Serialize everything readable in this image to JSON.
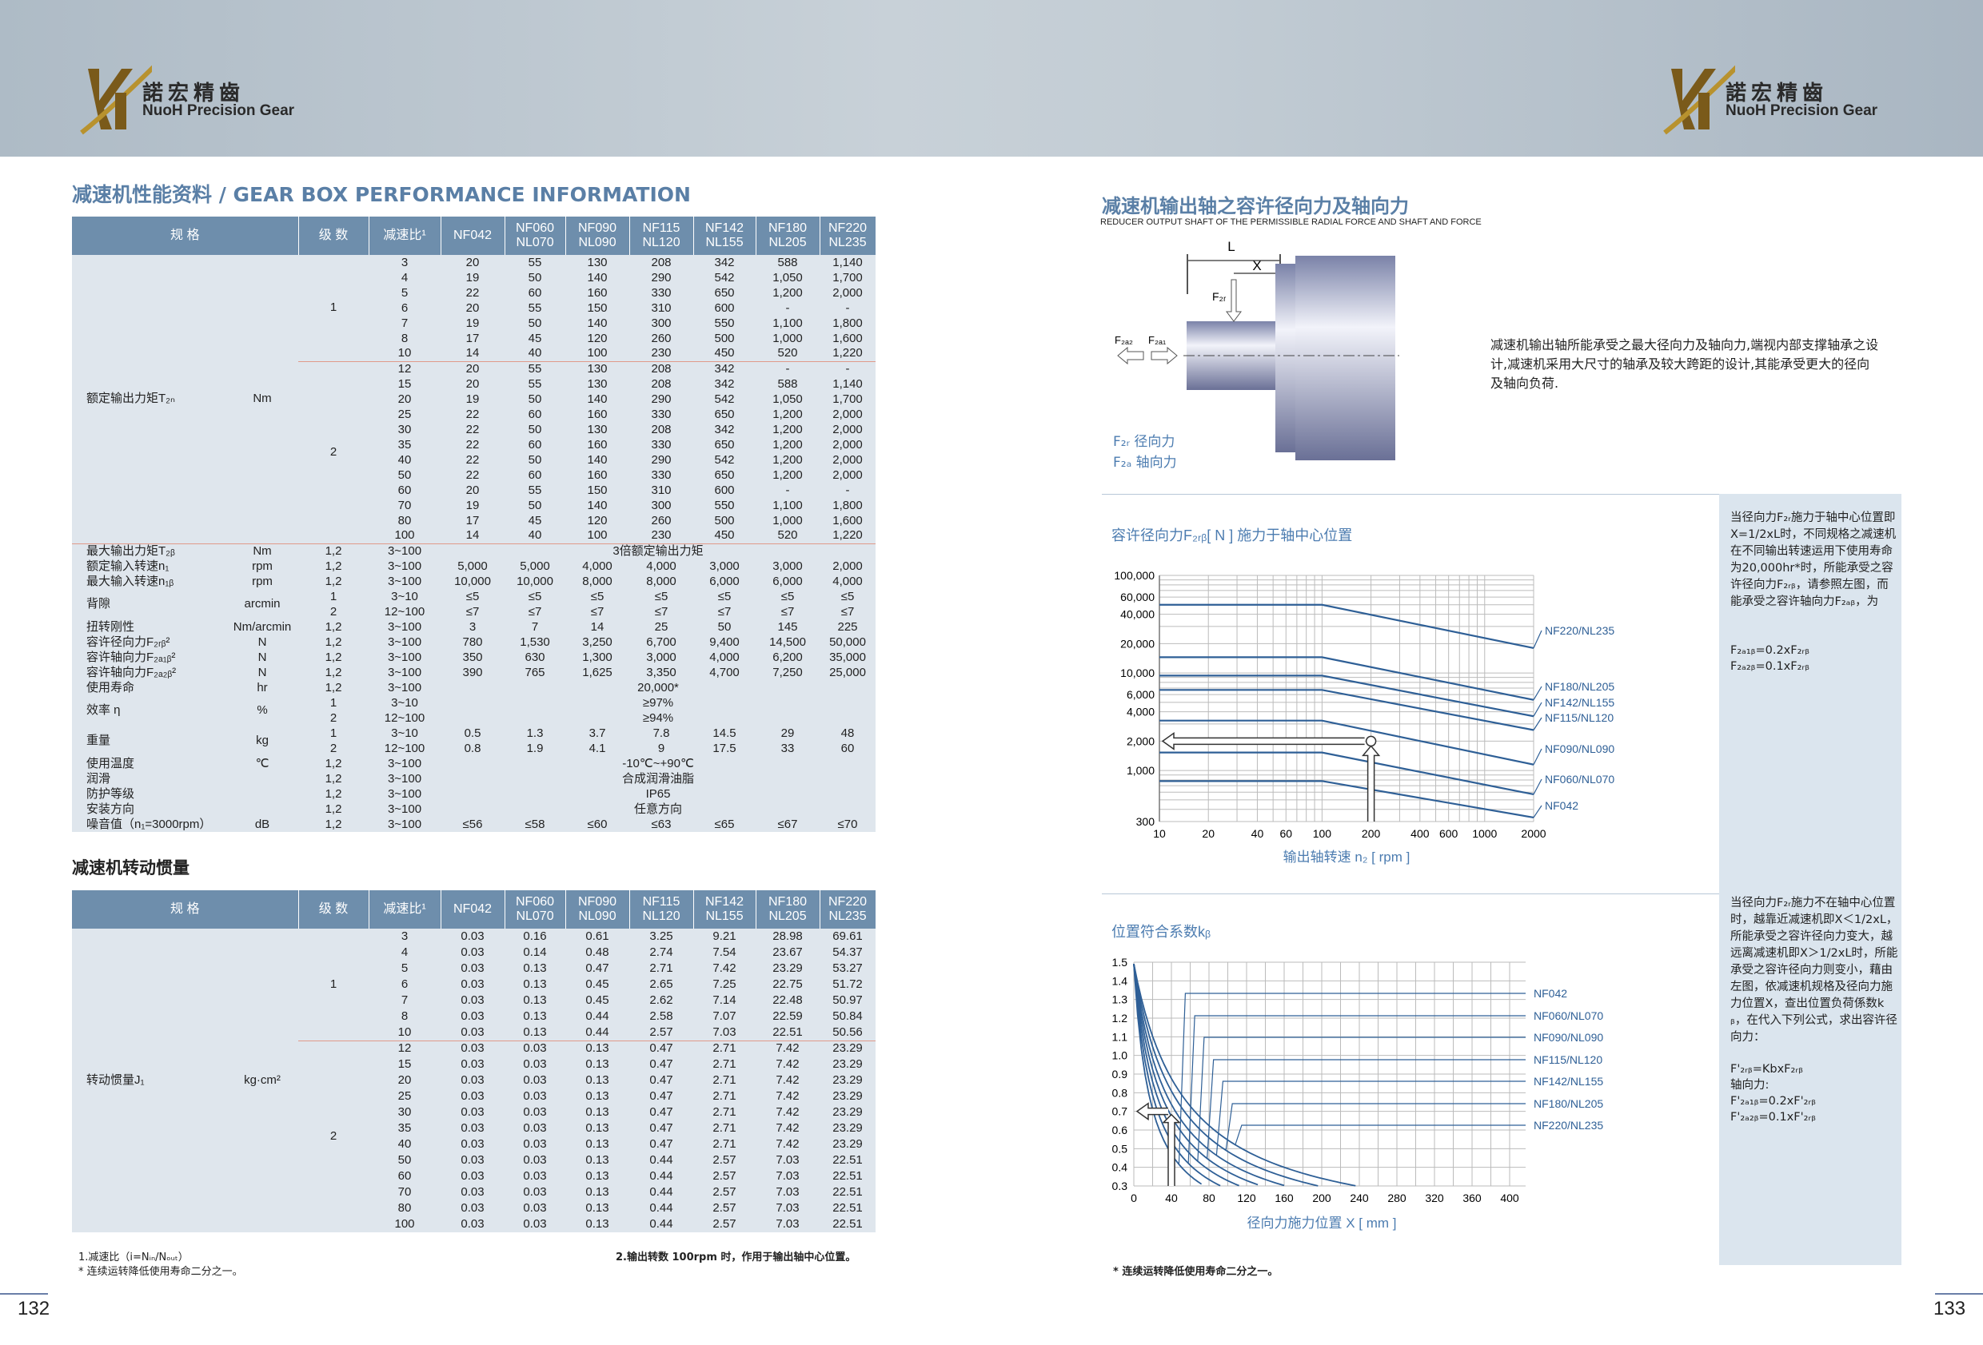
{
  "brand": {
    "cn": "諾宏精齒",
    "en": "NuoH Precision Gear"
  },
  "left": {
    "title": "减速机性能资料 / GEAR BOX PERFORMANCE INFORMATION",
    "columns": [
      "规 格",
      "级 数",
      "减速比¹",
      "NF042",
      "NF060\nNL070",
      "NF090\nNL090",
      "NF115\nNL120",
      "NF142\nNL155",
      "NF180\nNL205",
      "NF220\nNL235"
    ],
    "torque": {
      "label": "额定输出力矩T₂ₙ",
      "unit": "Nm",
      "stages": [
        {
          "stage": "1",
          "rows": [
            [
              "3",
              "20",
              "55",
              "130",
              "208",
              "342",
              "588",
              "1,140"
            ],
            [
              "4",
              "19",
              "50",
              "140",
              "290",
              "542",
              "1,050",
              "1,700"
            ],
            [
              "5",
              "22",
              "60",
              "160",
              "330",
              "650",
              "1,200",
              "2,000"
            ],
            [
              "6",
              "20",
              "55",
              "150",
              "310",
              "600",
              "-",
              "-"
            ],
            [
              "7",
              "19",
              "50",
              "140",
              "300",
              "550",
              "1,100",
              "1,800"
            ],
            [
              "8",
              "17",
              "45",
              "120",
              "260",
              "500",
              "1,000",
              "1,600"
            ],
            [
              "10",
              "14",
              "40",
              "100",
              "230",
              "450",
              "520",
              "1,220"
            ]
          ]
        },
        {
          "stage": "2",
          "rows": [
            [
              "12",
              "20",
              "55",
              "130",
              "208",
              "342",
              "-",
              "-"
            ],
            [
              "15",
              "20",
              "55",
              "130",
              "208",
              "342",
              "588",
              "1,140"
            ],
            [
              "20",
              "19",
              "50",
              "140",
              "290",
              "542",
              "1,050",
              "1,700"
            ],
            [
              "25",
              "22",
              "60",
              "160",
              "330",
              "650",
              "1,200",
              "2,000"
            ],
            [
              "30",
              "22",
              "50",
              "130",
              "208",
              "342",
              "1,200",
              "2,000"
            ],
            [
              "35",
              "22",
              "60",
              "160",
              "330",
              "650",
              "1,200",
              "2,000"
            ],
            [
              "40",
              "22",
              "50",
              "140",
              "290",
              "542",
              "1,200",
              "2,000"
            ],
            [
              "50",
              "22",
              "60",
              "160",
              "330",
              "650",
              "1,200",
              "2,000"
            ],
            [
              "60",
              "20",
              "55",
              "150",
              "310",
              "600",
              "-",
              "-"
            ],
            [
              "70",
              "19",
              "50",
              "140",
              "300",
              "550",
              "1,100",
              "1,800"
            ],
            [
              "80",
              "17",
              "45",
              "120",
              "260",
              "500",
              "1,000",
              "1,600"
            ],
            [
              "100",
              "14",
              "40",
              "100",
              "230",
              "450",
              "520",
              "1,220"
            ]
          ]
        }
      ]
    },
    "specs": [
      {
        "label": "最大输出力矩T₂ᵦ",
        "unit": "Nm",
        "stage": "1,2",
        "ratio": "3~100",
        "span": "3倍额定输出力矩"
      },
      {
        "label": "额定输入转速n₁",
        "unit": "rpm",
        "stage": "1,2",
        "ratio": "3~100",
        "vals": [
          "5,000",
          "5,000",
          "4,000",
          "4,000",
          "3,000",
          "3,000",
          "2,000"
        ]
      },
      {
        "label": "最大输入转速n₁ᵦ",
        "unit": "rpm",
        "stage": "1,2",
        "ratio": "3~100",
        "vals": [
          "10,000",
          "10,000",
          "8,000",
          "8,000",
          "6,000",
          "6,000",
          "4,000"
        ]
      },
      {
        "label": "背隙",
        "unit": "arcmin",
        "stage": "1",
        "ratio": "3~10",
        "vals": [
          "≤5",
          "≤5",
          "≤5",
          "≤5",
          "≤5",
          "≤5",
          "≤5"
        ]
      },
      {
        "label": "",
        "unit": "",
        "stage": "2",
        "ratio": "12~100",
        "vals": [
          "≤7",
          "≤7",
          "≤7",
          "≤7",
          "≤7",
          "≤7",
          "≤7"
        ]
      },
      {
        "label": "扭转刚性",
        "unit": "Nm/arcmin",
        "stage": "1,2",
        "ratio": "3~100",
        "vals": [
          "3",
          "7",
          "14",
          "25",
          "50",
          "145",
          "225"
        ]
      },
      {
        "label": "容许径向力F₂ᵣᵦ²",
        "unit": "N",
        "stage": "1,2",
        "ratio": "3~100",
        "vals": [
          "780",
          "1,530",
          "3,250",
          "6,700",
          "9,400",
          "14,500",
          "50,000"
        ]
      },
      {
        "label": "容许轴向力F₂ₐ₁ᵦ²",
        "unit": "N",
        "stage": "1,2",
        "ratio": "3~100",
        "vals": [
          "350",
          "630",
          "1,300",
          "3,000",
          "4,000",
          "6,200",
          "35,000"
        ]
      },
      {
        "label": "容许轴向力F₂ₐ₂ᵦ²",
        "unit": "N",
        "stage": "1,2",
        "ratio": "3~100",
        "vals": [
          "390",
          "765",
          "1,625",
          "3,350",
          "4,700",
          "7,250",
          "25,000"
        ]
      },
      {
        "label": "使用寿命",
        "unit": "hr",
        "stage": "1,2",
        "ratio": "3~100",
        "span": "20,000*"
      },
      {
        "label": "效率 η",
        "unit": "%",
        "stage": "1",
        "ratio": "3~10",
        "span": "≥97%"
      },
      {
        "label": "",
        "unit": "",
        "stage": "2",
        "ratio": "12~100",
        "span": "≥94%"
      },
      {
        "label": "重量",
        "unit": "kg",
        "stage": "1",
        "ratio": "3~10",
        "vals": [
          "0.5",
          "1.3",
          "3.7",
          "7.8",
          "14.5",
          "29",
          "48"
        ]
      },
      {
        "label": "",
        "unit": "",
        "stage": "2",
        "ratio": "12~100",
        "vals": [
          "0.8",
          "1.9",
          "4.1",
          "9",
          "17.5",
          "33",
          "60"
        ]
      },
      {
        "label": "使用温度",
        "unit": "℃",
        "stage": "1,2",
        "ratio": "3~100",
        "span": "-10℃~+90℃"
      },
      {
        "label": "润滑",
        "unit": "",
        "stage": "1,2",
        "ratio": "3~100",
        "span": "合成润滑油脂"
      },
      {
        "label": "防护等级",
        "unit": "",
        "stage": "1,2",
        "ratio": "3~100",
        "span": "IP65"
      },
      {
        "label": "安装方向",
        "unit": "",
        "stage": "1,2",
        "ratio": "3~100",
        "span": "任意方向"
      },
      {
        "label": "噪音值（n₁=3000rpm）",
        "unit": "dB",
        "stage": "1,2",
        "ratio": "3~100",
        "vals": [
          "≤56",
          "≤58",
          "≤60",
          "≤63",
          "≤65",
          "≤67",
          "≤70"
        ]
      }
    ],
    "inertia_title": "减速机转动惯量",
    "inertia": {
      "label": "转动惯量J₁",
      "unit": "kg·cm²",
      "stages": [
        {
          "stage": "1",
          "rows": [
            [
              "3",
              "0.03",
              "0.16",
              "0.61",
              "3.25",
              "9.21",
              "28.98",
              "69.61"
            ],
            [
              "4",
              "0.03",
              "0.14",
              "0.48",
              "2.74",
              "7.54",
              "23.67",
              "54.37"
            ],
            [
              "5",
              "0.03",
              "0.13",
              "0.47",
              "2.71",
              "7.42",
              "23.29",
              "53.27"
            ],
            [
              "6",
              "0.03",
              "0.13",
              "0.45",
              "2.65",
              "7.25",
              "22.75",
              "51.72"
            ],
            [
              "7",
              "0.03",
              "0.13",
              "0.45",
              "2.62",
              "7.14",
              "22.48",
              "50.97"
            ],
            [
              "8",
              "0.03",
              "0.13",
              "0.44",
              "2.58",
              "7.07",
              "22.59",
              "50.84"
            ],
            [
              "10",
              "0.03",
              "0.13",
              "0.44",
              "2.57",
              "7.03",
              "22.51",
              "50.56"
            ]
          ]
        },
        {
          "stage": "2",
          "rows": [
            [
              "12",
              "0.03",
              "0.03",
              "0.13",
              "0.47",
              "2.71",
              "7.42",
              "23.29"
            ],
            [
              "15",
              "0.03",
              "0.03",
              "0.13",
              "0.47",
              "2.71",
              "7.42",
              "23.29"
            ],
            [
              "20",
              "0.03",
              "0.03",
              "0.13",
              "0.47",
              "2.71",
              "7.42",
              "23.29"
            ],
            [
              "25",
              "0.03",
              "0.03",
              "0.13",
              "0.47",
              "2.71",
              "7.42",
              "23.29"
            ],
            [
              "30",
              "0.03",
              "0.03",
              "0.13",
              "0.47",
              "2.71",
              "7.42",
              "23.29"
            ],
            [
              "35",
              "0.03",
              "0.03",
              "0.13",
              "0.47",
              "2.71",
              "7.42",
              "23.29"
            ],
            [
              "40",
              "0.03",
              "0.03",
              "0.13",
              "0.47",
              "2.71",
              "7.42",
              "23.29"
            ],
            [
              "50",
              "0.03",
              "0.03",
              "0.13",
              "0.44",
              "2.57",
              "7.03",
              "22.51"
            ],
            [
              "60",
              "0.03",
              "0.03",
              "0.13",
              "0.44",
              "2.57",
              "7.03",
              "22.51"
            ],
            [
              "70",
              "0.03",
              "0.03",
              "0.13",
              "0.44",
              "2.57",
              "7.03",
              "22.51"
            ],
            [
              "80",
              "0.03",
              "0.03",
              "0.13",
              "0.44",
              "2.57",
              "7.03",
              "22.51"
            ],
            [
              "100",
              "0.03",
              "0.03",
              "0.13",
              "0.44",
              "2.57",
              "7.03",
              "22.51"
            ]
          ]
        }
      ]
    },
    "foot1": "1.减速比（i=Nᵢₙ/Nₒᵤₜ）",
    "foot2": "* 连续运转降低使用寿命二分之一。",
    "foot3": "2.输出转数 100rpm 时，作用于输出轴中心位置。",
    "page": "132"
  },
  "right": {
    "title": "减速机输出轴之容许径向力及轴向力",
    "subtitle": "REDUCER OUTPUT SHAFT OF THE PERMISSIBLE RADIAL FORCE AND SHAFT AND FORCE",
    "diagram": {
      "L": "L",
      "X": "X",
      "F2r": "F₂ᵣ",
      "F2a2": "F₂ₐ₂",
      "F2a1": "F₂ₐ₁"
    },
    "legend1": "F₂ᵣ 径向力",
    "legend2": "F₂ₐ 轴向力",
    "desc": "减速机输出轴所能承受之最大径向力及轴向力,端视内部支撑轴承之设计,减速机采用大尺寸的轴承及较大跨距的设计,其能承受更大的径向及轴向负荷.",
    "note1": "当径向力F₂ᵣ施力于轴中心位置即X=1/2xL时，不同规格之减速机在不同输出转速运用下使用寿命为20,000hr*时，所能承受之容许径向力F₂ᵣᵦ，请参照左图，而能承受之容许轴向力F₂ₐᵦ，为",
    "note1_f1": "F₂ₐ₁ᵦ=0.2xF₂ᵣᵦ",
    "note1_f2": "F₂ₐ₂ᵦ=0.1xF₂ᵣᵦ",
    "note2": "当径向力F₂ᵣ施力不在轴中心位置时，越靠近减速机即X＜1/2xL，所能承受之容许径向力变大，越远离减速机即X＞1/2xL时，所能承受之容许径向力则变小，藉由左图，依减速机规格及径向力施力位置X，查出位置负荷係数kᵦ，在代入下列公式，求出容许径向力：",
    "note2_f1": "F'₂ᵣᵦ=KbxF₂ᵣᵦ",
    "note2_f2": "轴向力:",
    "note2_f3": "F'₂ₐ₁ᵦ=0.2xF'₂ᵣᵦ",
    "note2_f4": "F'₂ₐ₂ᵦ=0.1xF'₂ᵣᵦ",
    "foot": "* 连续运转降低使用寿命二分之一。",
    "page": "133"
  },
  "chart_data": [
    {
      "type": "line",
      "title": "容许径向力F₂ᵣᵦ[ N ]  施力于轴中心位置",
      "xlabel": "输出轴转速 n₂ [ rpm ]",
      "ylabel": "",
      "xscale": "log",
      "yscale": "log",
      "xlim": [
        10,
        2000
      ],
      "ylim": [
        300,
        100000
      ],
      "x_ticks": [
        "10",
        "20",
        "40",
        "60",
        "100",
        "200",
        "400",
        "600",
        "1000",
        "2000"
      ],
      "y_ticks": [
        "100,000",
        "60,000",
        "40,000",
        "20,000",
        "10,000",
        "6,000",
        "4,000",
        "2,000",
        "1,000",
        "300"
      ],
      "series": [
        {
          "name": "NF220/NL235",
          "x": [
            10,
            100,
            2000
          ],
          "y": [
            50000,
            50000,
            18000
          ]
        },
        {
          "name": "NF180/NL205",
          "x": [
            10,
            100,
            2000
          ],
          "y": [
            14500,
            14500,
            5300
          ]
        },
        {
          "name": "NF142/NL155",
          "x": [
            10,
            100,
            2000
          ],
          "y": [
            9400,
            9400,
            3600
          ]
        },
        {
          "name": "NF115/NL120",
          "x": [
            10,
            100,
            2000
          ],
          "y": [
            6700,
            6700,
            2600
          ]
        },
        {
          "name": "NF090/NL090",
          "x": [
            10,
            100,
            2000
          ],
          "y": [
            3250,
            3250,
            1150
          ]
        },
        {
          "name": "NF060/NL070",
          "x": [
            10,
            100,
            2000
          ],
          "y": [
            1530,
            1530,
            570
          ]
        },
        {
          "name": "NF042",
          "x": [
            10,
            100,
            2000
          ],
          "y": [
            780,
            780,
            330
          ]
        }
      ]
    },
    {
      "type": "line",
      "title": "位置符合系数kᵦ",
      "xlabel": "径向力施力位置 X [ mm ]",
      "ylabel": "",
      "xlim": [
        0,
        400
      ],
      "ylim": [
        0.3,
        1.5
      ],
      "x_ticks": [
        "0",
        "40",
        "80",
        "120",
        "160",
        "200",
        "240",
        "280",
        "320",
        "360",
        "400"
      ],
      "y_ticks": [
        "1.5",
        "1.4",
        "1.3",
        "1.2",
        "1.1",
        "1.0",
        "0.9",
        "0.8",
        "0.7",
        "0.6",
        "0.5",
        "0.4",
        "0.3"
      ],
      "series": [
        {
          "name": "NF042",
          "k": 26
        },
        {
          "name": "NF060/NL070",
          "k": 32
        },
        {
          "name": "NF090/NL090",
          "k": 39
        },
        {
          "name": "NF115/NL120",
          "k": 47
        },
        {
          "name": "NF142/NL155",
          "k": 56
        },
        {
          "name": "NF180/NL205",
          "k": 68
        },
        {
          "name": "NF220/NL235",
          "k": 82
        }
      ]
    }
  ]
}
